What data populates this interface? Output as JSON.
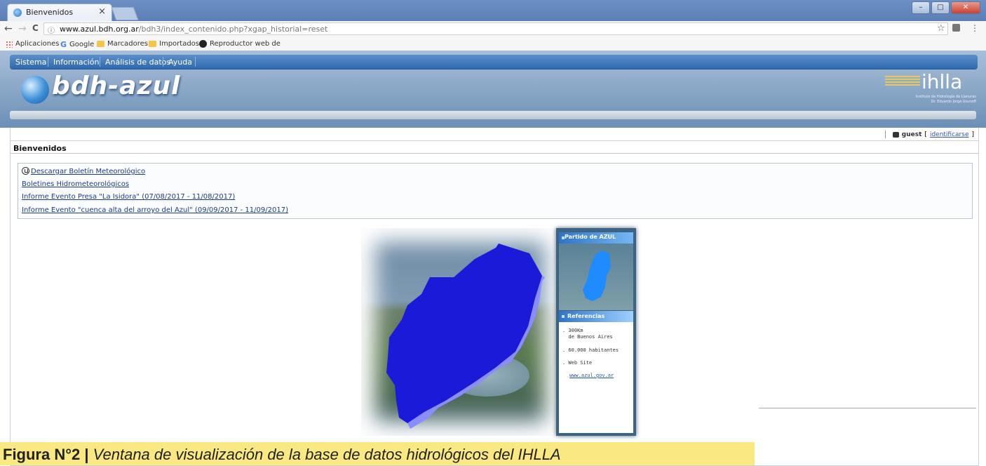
{
  "browser": {
    "tab_title": "Bienvenidos",
    "tab_close": "×",
    "url_domain": "www.azul.bdh.org.ar",
    "url_path": "/bdh3/index_contenido.php?xgap_historial=reset",
    "nav": {
      "back": "←",
      "forward": "→",
      "reload": "C"
    },
    "bookmarks": [
      {
        "label": "Aplicaciones",
        "icon": "apps-icon"
      },
      {
        "label": "Google",
        "icon": "google-icon"
      },
      {
        "label": "Marcadores",
        "icon": "folder-icon"
      },
      {
        "label": "Importados",
        "icon": "folder-icon"
      },
      {
        "label": "Reproductor web de",
        "icon": "spotify-icon"
      }
    ]
  },
  "site": {
    "menu": [
      "Sistema",
      "Información",
      "Análisis de datos",
      "Ayuda"
    ],
    "logo_text": "bdh-azul",
    "ihlla_text": "ihlla",
    "ihlla_sub": "Instituto de Hidrología de Llanuras\nDr. Eduardo Jorge Usunoff"
  },
  "userbar": {
    "user": "guest",
    "login_link": "identificarse"
  },
  "page_title": "Bienvenidos",
  "links": [
    "Descargar Boletín Meteorológico",
    "Boletines Hidrometeorológicos",
    "Informe Evento Presa \"La Isidora\" (07/08/2017 - 11/08/2017)",
    "Informe Evento \"cuenca alta del arroyo del Azul\" (09/09/2017 - 11/09/2017)"
  ],
  "map_panel": {
    "title": "Partido de AZUL",
    "references_title": "Referencias",
    "ref_distance": ". 300Km\n  de Buenos Aires",
    "ref_population": ". 60.000 habitantes",
    "ref_web": ". Web Site",
    "ref_url": "www.azul.gov.ar"
  },
  "caption": {
    "prefix": "Figura N°2 |",
    "text": " Ventana de visualización de la base de datos hidrológicos del IHLLA"
  },
  "colors": {
    "accent": "#2d6aae",
    "map_fill": "#1a1ad8",
    "caption_bg": "#fae983"
  }
}
